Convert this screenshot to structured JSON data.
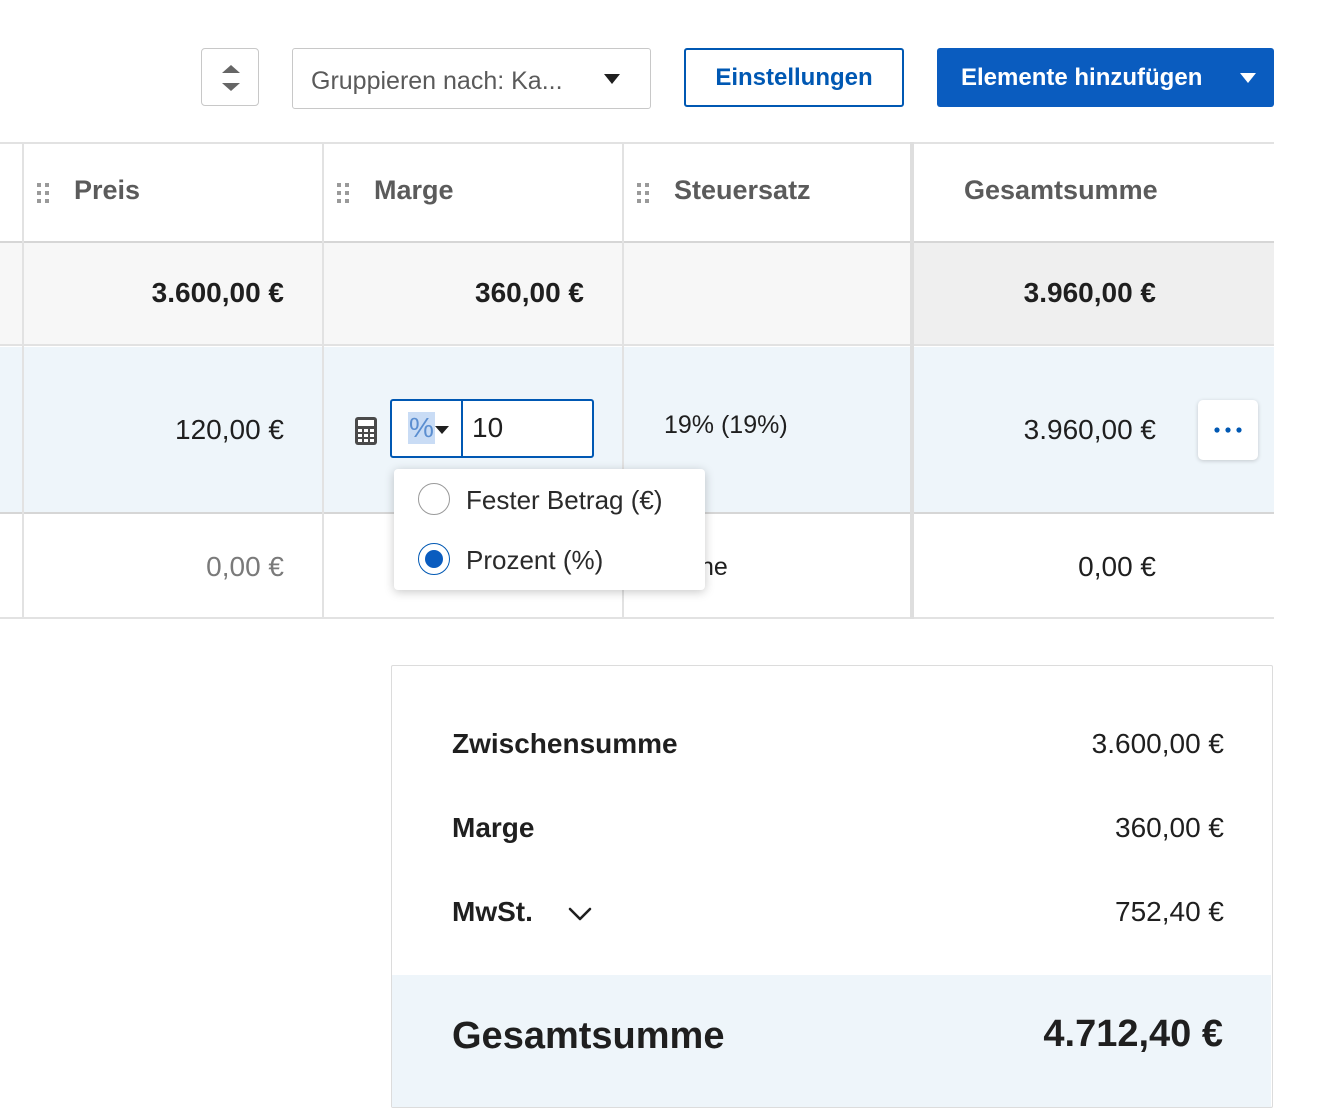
{
  "toolbar": {
    "group_by_label": "Gruppieren nach: Ka...",
    "settings_label": "Einstellungen",
    "add_items_label": "Elemente hinzufügen"
  },
  "table": {
    "columns": [
      "Preis",
      "Marge",
      "Steuersatz",
      "Gesamtsumme"
    ],
    "group_row": {
      "price": "3.600,00 €",
      "margin": "360,00 €",
      "tax": "",
      "total": "3.960,00 €"
    },
    "item_row": {
      "price": "120,00 €",
      "margin_unit": "%",
      "margin_value": "10",
      "tax": "19% (19%)",
      "total": "3.960,00 €"
    },
    "empty_row": {
      "price": "0,00 €",
      "tax_partial": "ne",
      "total": "0,00 €"
    }
  },
  "margin_unit_menu": {
    "options": [
      "Fester Betrag (€)",
      "Prozent (%)"
    ],
    "selected": "Prozent (%)"
  },
  "summary": {
    "subtotal_label": "Zwischensumme",
    "subtotal_value": "3.600,00 €",
    "margin_label": "Marge",
    "margin_value": "360,00 €",
    "vat_label": "MwSt.",
    "vat_value": "752,40 €",
    "grand_total_label": "Gesamtsumme",
    "grand_total_value": "4.712,40 €"
  },
  "colors": {
    "primary": "#0a5cbf",
    "selected_row": "#eef5fa",
    "group_row": "#f7f7f7"
  },
  "icons": [
    "sort-icon",
    "caret-down-icon",
    "drag-handle-icon",
    "calculator-icon",
    "more-options-icon",
    "chevron-down-icon"
  ]
}
